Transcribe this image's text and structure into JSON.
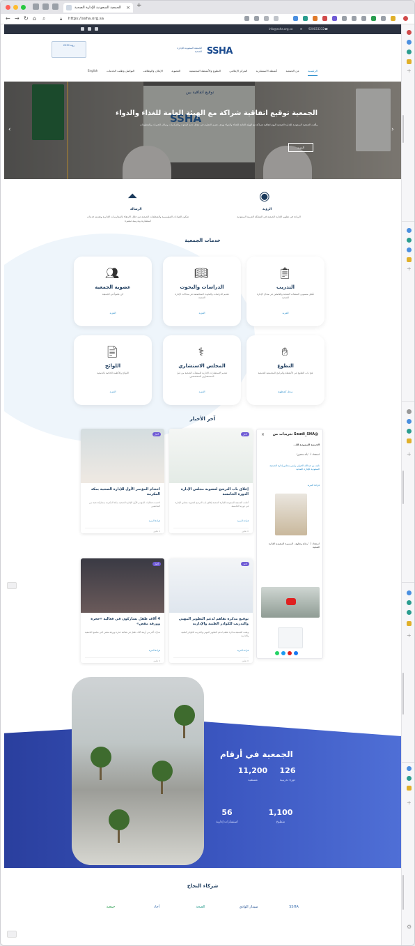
{
  "browser": {
    "tab_title": "الجمعية السعودية للإدارة الصحية",
    "url": "https://ssha.org.sa"
  },
  "site": {
    "topbar_email": "info@ssha.org.sa",
    "topbar_phone": "920033232",
    "vision_logo_text": "رؤية 2030",
    "brand_word": "SSHA",
    "brand_ar": "الجمعية السعودية للإدارة الصحية",
    "nav": [
      "الرئيسية",
      "عن الجمعية",
      "أنشطة الاستشارية",
      "المركز الإعلامي",
      "التطوع والأنشطة المجتمعية",
      "العضوية",
      "الإعلان والوظائف",
      "التواصل وطلب الخدمات",
      "English"
    ]
  },
  "hero": {
    "screen_title": "توقيع اتفاقية بين",
    "screen_brand": "SSHA",
    "title": "الجمعية توقيع اتفاقية شراكة مع الهيئة العامة للغذاء والدواء",
    "text": "وقّعت الجمعية السعودية للإدارة الصحية اليوم اتفاقية شراكة مع الهيئة العامة للغذاء والدواء بهدف تعزيز التعاون في مجال دعم البحوث والدراسات وتبادل الخبرات والمعلومات",
    "more_label": "المزيد"
  },
  "about": {
    "vision_title": "الرؤية",
    "vision_text": "الريادة في تطوير الإدارة الصحية في المملكة العربية السعودية",
    "mission_title": "الرسالة",
    "mission_text": "تمكين القيادات المؤسسية والمنظمات الصحية من خلال الارتقاء بالممارسات الإدارية وتقديم خدمات استشارية وتدريبية متميزة"
  },
  "services": {
    "title": "خدمات الجمعية",
    "cards": [
      {
        "title": "التدريب",
        "desc": "تأهيل منسوبي المنشآت الصحية والعاملين في مجال الإدارة الصحية",
        "link": "المزيد",
        "icon": "training-icon"
      },
      {
        "title": "الدراسات والبحوث",
        "desc": "تقديم الدراسات والبحوث المتخصصة في مجالات الإدارة الصحية",
        "link": "المزيد",
        "icon": "book-icon"
      },
      {
        "title": "عضوية الجمعية",
        "desc": "كن عضواً في الجمعية",
        "link": "المزيد",
        "icon": "members-icon"
      },
      {
        "title": "التطوع",
        "desc": "فتح باب التطوع في الأنشطة والبرامج المجتمعية للجمعية",
        "link": "سجل كمتطوع",
        "icon": "volunteer-icon"
      },
      {
        "title": "المجلس الاستشاري",
        "desc": "تقديم الاستشارات الإدارية للمنشآت الصحية من قبل المستشارين المتخصصين",
        "link": "المزيد",
        "icon": "council-icon"
      },
      {
        "title": "اللوائح",
        "desc": "اللوائح والأنظمة الخاصة بالجمعية",
        "link": "المزيد",
        "icon": "document-icon"
      }
    ]
  },
  "news": {
    "title": "آخر الأخبار",
    "items": [
      {
        "badge": "أخبار",
        "title": "إغلاق باب الترشح لعضوية مجلس الإدارة الدورة الخامسة",
        "text": "أعلنت الجمعية السعودية للإدارة الصحية إغلاق باب الترشح لعضوية مجلس الإدارة في دورته الخامسة",
        "more": "قراءة المزيد",
        "meta": "0 تعليق"
      },
      {
        "badge": "أخبار",
        "title": "اختتام المؤتمر الأول للإدارة الصحية بمكة المكرمة",
        "text": "اختتمت فعاليات المؤتمر الأول للإدارة الصحية بمكة المكرمة بمشاركة نخبة من المختصين",
        "more": "قراءة المزيد",
        "meta": "0 تعليق"
      },
      {
        "badge": "أخبار",
        "title": "توقيع مذكرة تفاهم لدعم التطوير المهني والتدريب للكوادر الطبية والإدارية",
        "text": "وقعت الجمعية مذكرة تفاهم لدعم التطوير المهني والتدريب للكوادر الطبية والإدارية",
        "more": "قراءة المزيد",
        "meta": "0 تعليق"
      },
      {
        "badge": "أخبار",
        "title": "4 آلاف طفل يشاركون في فعالية «حجرة وورقة مقص»",
        "text": "شارك أكثر من أربعة آلاف طفل في فعالية حجرة وورقة مقص التي نظمتها الجمعية",
        "more": "قراءة المزيد",
        "meta": "0 تعليق"
      }
    ],
    "pager": "< السابق   التالي >"
  },
  "twitter": {
    "header": "تغريدات من Saudi_SHA@",
    "account": "الجمعية السعودية للإ...",
    "tweet1": "استعداد أ. ' بأنه متصور!",
    "tweet2": "نايف بن عبدالله الخولي رئيس مجلس إدارة الجمعية السعودية للإدارة الصحية",
    "read_more": "قراءة المزيد",
    "tweet3": "استعداد أ. ' رعاية وتطوع - المسيرة السعودية للإدارة الصحية"
  },
  "stats": {
    "title": "الجمعية في أرقام",
    "items": [
      {
        "value": "126",
        "label": "دورة تدريبية"
      },
      {
        "value": "11,200",
        "label": "مستفيد"
      },
      {
        "value": "1,100",
        "label": "متطوع"
      },
      {
        "value": "56",
        "label": "استشارات إدارية"
      }
    ]
  },
  "partners": {
    "title": "شركاء النجاح",
    "items": [
      "SSHA",
      "سيدار الوادي",
      "الصحة",
      "أجاد",
      "جمعية"
    ]
  },
  "colors": {
    "brand_blue": "#1b4b8f",
    "accent": "#1f88c9",
    "stats_bg": "#3b56c0"
  }
}
